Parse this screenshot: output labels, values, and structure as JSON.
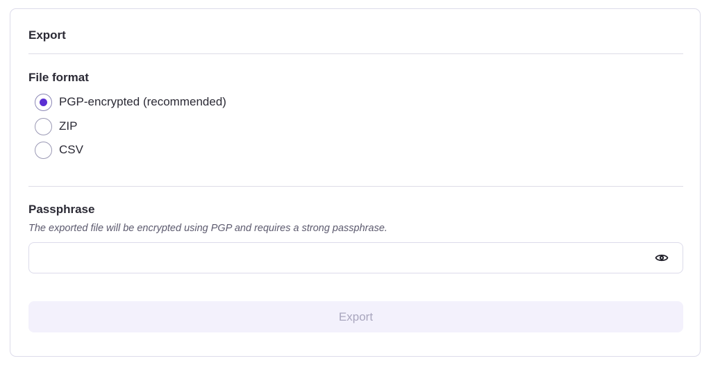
{
  "card": {
    "title": "Export"
  },
  "file_format": {
    "label": "File format",
    "options": [
      {
        "label": "PGP-encrypted (recommended)",
        "checked": true
      },
      {
        "label": "ZIP",
        "checked": false
      },
      {
        "label": "CSV",
        "checked": false
      }
    ]
  },
  "passphrase": {
    "label": "Passphrase",
    "hint": "The exported file will be encrypted using PGP and requires a strong passphrase.",
    "value": "",
    "toggle_icon": "eye-icon"
  },
  "actions": {
    "export_label": "Export",
    "export_disabled": true
  },
  "colors": {
    "accent": "#5b2fd3",
    "border": "#dcdbea",
    "button_bg_disabled": "#f3f1fc",
    "button_text_disabled": "#a9a6be"
  }
}
